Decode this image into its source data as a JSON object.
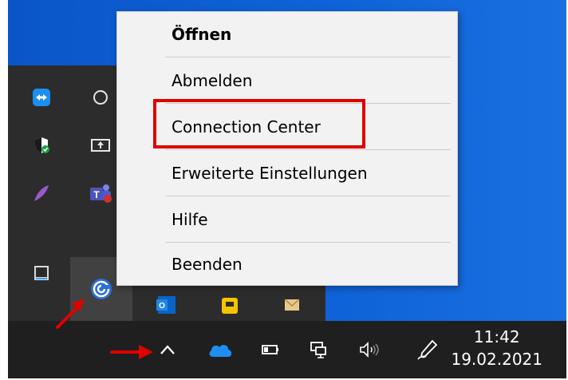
{
  "context_menu": {
    "items": [
      {
        "label": "Öffnen",
        "bold": true
      },
      {
        "label": "Abmelden"
      },
      {
        "label": "Connection Center"
      },
      {
        "label": "Erweiterte Einstellungen"
      },
      {
        "label": "Hilfe"
      },
      {
        "label": "Beenden"
      }
    ],
    "highlighted_item": "Connection Center"
  },
  "clock": {
    "time": "11:42",
    "date": "19.02.2021"
  },
  "colors": {
    "desktop": "#0f63d8",
    "flyout": "#2c2c2c",
    "taskbar": "#1f1f1f",
    "menu_bg": "#f2f2f2",
    "annotation_red": "#e00000"
  },
  "tray_icons": [
    "teamviewer-icon",
    "cortana-circle-icon",
    "security-shield-icon",
    "screen-share-icon",
    "feather-pen-icon",
    "teams-icon",
    "window-tile-icon",
    "citrix-workspace-icon",
    "outlook-icon",
    "sticky-note-icon",
    "mail-icon"
  ],
  "taskbar_icons": [
    "show-hidden-icons-chevron",
    "onedrive-cloud-icon",
    "battery-icon",
    "network-icon",
    "volume-icon",
    "pen-workspace-icon"
  ]
}
